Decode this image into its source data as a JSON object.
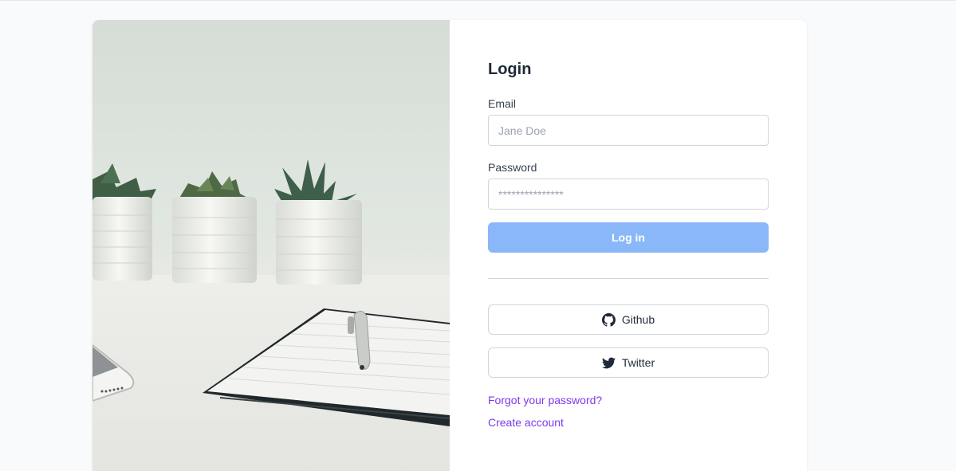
{
  "login": {
    "title": "Login",
    "email_label": "Email",
    "email_placeholder": "Jane Doe",
    "password_label": "Password",
    "password_placeholder": "***************",
    "login_button": "Log in",
    "github_button": "Github",
    "twitter_button": "Twitter",
    "forgot_password_link": "Forgot your password?",
    "create_account_link": "Create account"
  },
  "colors": {
    "primary_button": "#8ab7f8",
    "link": "#7c3aed",
    "page_background": "#f9fafb"
  },
  "icons": {
    "github": "github-icon",
    "twitter": "twitter-icon"
  }
}
